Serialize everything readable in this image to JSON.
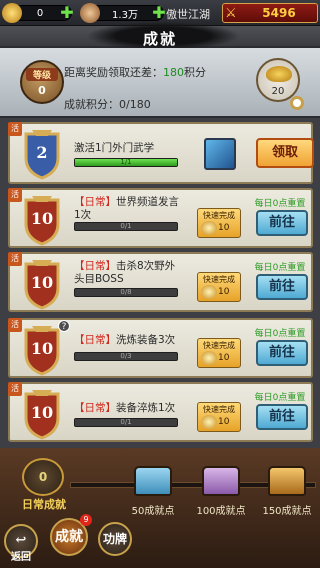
{
  "top": {
    "ingot_value": "0",
    "copper_value": "1.3万",
    "server_name": "傲世江湖",
    "power_value": "5496",
    "plus_glyph": "✚"
  },
  "header": {
    "title": "成就"
  },
  "info": {
    "rank_label": "等级",
    "rank_value": "0",
    "next_reward_prefix": "距离奖励领取还差：",
    "next_reward_points": "180",
    "next_reward_suffix": "积分",
    "score_label": "成就积分：0/180",
    "reward_count": "20"
  },
  "tasks": [
    {
      "ribbon": "活",
      "level": "2",
      "tag": "",
      "text": "激活1门外门武学",
      "progress": "1/1",
      "progress_fraction": 1.0,
      "action": "领取",
      "side_item": "cube"
    },
    {
      "ribbon": "活",
      "level": "10",
      "tag": "【日常】",
      "text": "世界频道发言1次",
      "progress": "0/1",
      "progress_fraction": 0.0,
      "quick_label": "快速完成",
      "quick_cost": "10",
      "reset": "每日0点重置",
      "action": "前往"
    },
    {
      "ribbon": "活",
      "level": "10",
      "tag": "【日常】",
      "text": "击杀8次野外头目BOSS",
      "progress": "0/8",
      "progress_fraction": 0.0,
      "quick_label": "快速完成",
      "quick_cost": "10",
      "reset": "每日0点重置",
      "action": "前往"
    },
    {
      "ribbon": "活",
      "level": "10",
      "tag": "【日常】",
      "text": "洗炼装备3次",
      "progress": "0/3",
      "progress_fraction": 0.0,
      "quick_label": "快速完成",
      "quick_cost": "10",
      "reset": "每日0点重置",
      "action": "前往"
    },
    {
      "ribbon": "活",
      "level": "10",
      "tag": "【日常】",
      "text": "装备淬炼1次",
      "progress": "0/1",
      "progress_fraction": 0.0,
      "quick_label": "快速完成",
      "quick_cost": "10",
      "reset": "每日0点重置",
      "action": "前往"
    }
  ],
  "daily": {
    "badge_value": "0",
    "label": "日常成就",
    "chests": [
      "50成就点",
      "100成就点",
      "150成就点"
    ]
  },
  "nav": {
    "back": "返回",
    "achievement": "成就",
    "fame": "功牌",
    "badge_count": "9"
  }
}
